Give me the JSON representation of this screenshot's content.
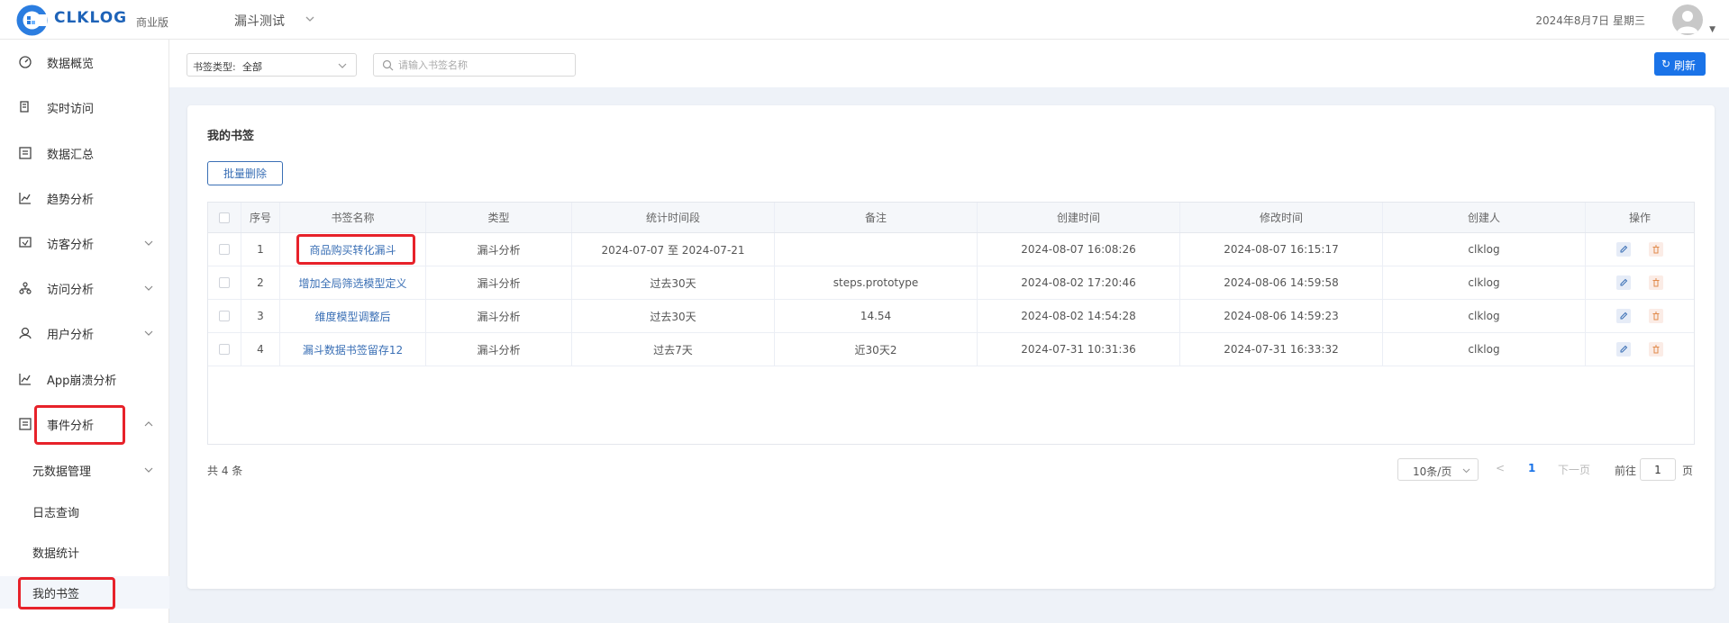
{
  "header": {
    "logo_text": "CLKLOG",
    "edition": "商业版",
    "project": "漏斗测试",
    "date": "2024年8月7日 星期三"
  },
  "sidebar": {
    "items": [
      {
        "label": "数据概览",
        "icon": "dashboard-icon"
      },
      {
        "label": "实时访问",
        "icon": "realtime-icon"
      },
      {
        "label": "数据汇总",
        "icon": "summary-icon"
      },
      {
        "label": "趋势分析",
        "icon": "trend-icon"
      },
      {
        "label": "访客分析",
        "icon": "visitor-icon"
      },
      {
        "label": "访问分析",
        "icon": "visit-icon"
      },
      {
        "label": "用户分析",
        "icon": "user-icon"
      },
      {
        "label": "App崩溃分析",
        "icon": "crash-icon"
      },
      {
        "label": "事件分析",
        "icon": "event-icon"
      }
    ],
    "sub_items": [
      {
        "label": "元数据管理"
      },
      {
        "label": "日志查询"
      },
      {
        "label": "数据统计"
      },
      {
        "label": "我的书签"
      }
    ]
  },
  "filter": {
    "type_prefix": "书签类型:",
    "type_value": "全部",
    "search_placeholder": "请输入书签名称",
    "refresh_label": "刷新"
  },
  "card": {
    "title": "我的书签",
    "batch_delete": "批量删除"
  },
  "table": {
    "headers": [
      "序号",
      "书签名称",
      "类型",
      "统计时间段",
      "备注",
      "创建时间",
      "修改时间",
      "创建人",
      "操作"
    ],
    "rows": [
      [
        "1",
        "商品购买转化漏斗",
        "漏斗分析",
        "2024-07-07 至 2024-07-21",
        "",
        "2024-08-07 16:08:26",
        "2024-08-07 16:15:17",
        "clklog"
      ],
      [
        "2",
        "增加全局筛选模型定义",
        "漏斗分析",
        "过去30天",
        "steps.prototype",
        "2024-08-02 17:20:46",
        "2024-08-06 14:59:58",
        "clklog"
      ],
      [
        "3",
        "维度模型调整后",
        "漏斗分析",
        "过去30天",
        "14.54",
        "2024-08-02 14:54:28",
        "2024-08-06 14:59:23",
        "clklog"
      ],
      [
        "4",
        "漏斗数据书签留存12",
        "漏斗分析",
        "过去7天",
        "近30天2",
        "2024-07-31 10:31:36",
        "2024-07-31 16:33:32",
        "clklog"
      ]
    ]
  },
  "pagination": {
    "total": "共 4 条",
    "page_size": "10条/页",
    "prev": "<",
    "current_page": "1",
    "next": "下一页",
    "goto_label": "前往",
    "goto_value": "1",
    "goto_suffix": "页"
  },
  "colors": {
    "primary": "#1a73e8",
    "link": "#3a6fb5",
    "highlight": "#e7222a"
  }
}
